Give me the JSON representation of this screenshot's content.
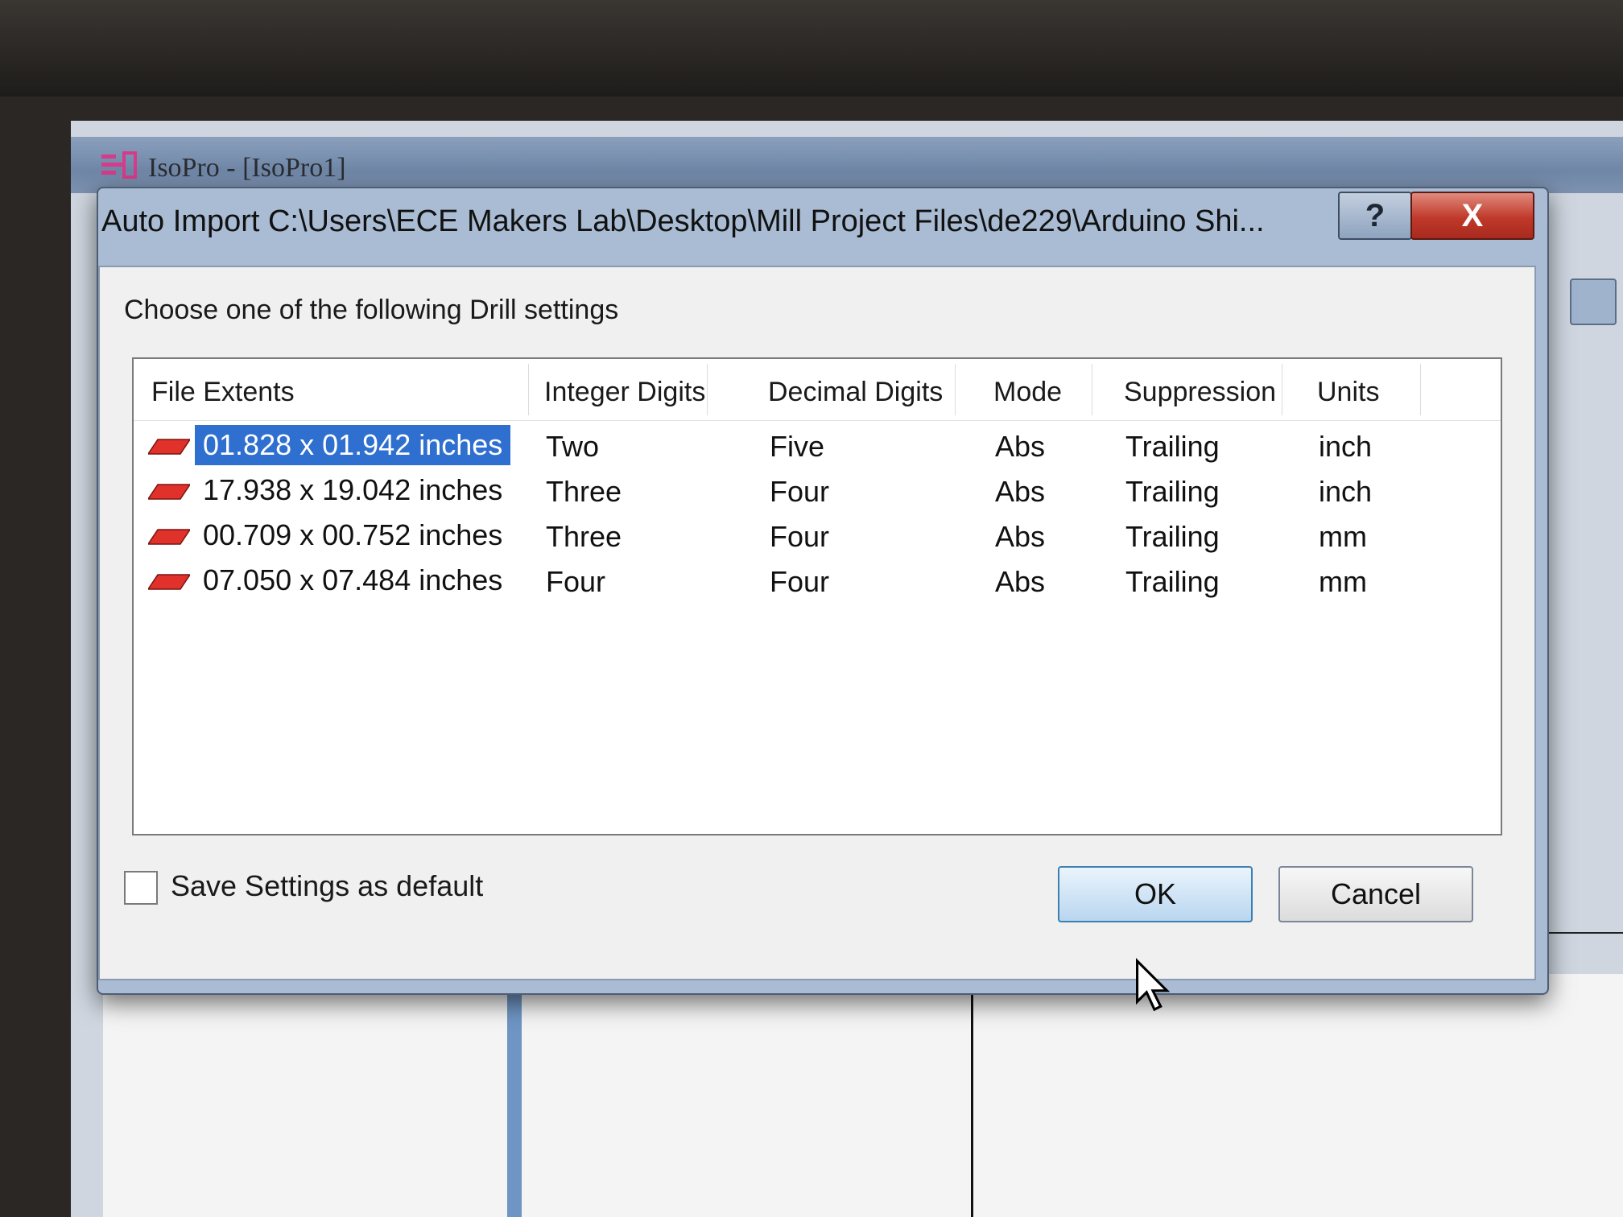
{
  "app": {
    "title": "IsoPro - [IsoPro1]"
  },
  "dialog": {
    "title": "Auto Import C:\\Users\\ECE Makers Lab\\Desktop\\Mill Project Files\\de229\\Arduino Shi...",
    "help_label": "?",
    "close_label": "X",
    "prompt": "Choose one of the following Drill settings",
    "columns": [
      "File Extents",
      "Integer Digits",
      "Decimal Digits",
      "Mode",
      "Suppression",
      "Units"
    ],
    "rows": [
      {
        "extents": "01.828 x 01.942 inches",
        "integer": "Two",
        "decimal": "Five",
        "mode": "Abs",
        "suppression": "Trailing",
        "units": "inch",
        "selected": true
      },
      {
        "extents": "17.938 x 19.042 inches",
        "integer": "Three",
        "decimal": "Four",
        "mode": "Abs",
        "suppression": "Trailing",
        "units": "inch",
        "selected": false
      },
      {
        "extents": "00.709 x 00.752 inches",
        "integer": "Three",
        "decimal": "Four",
        "mode": "Abs",
        "suppression": "Trailing",
        "units": "mm",
        "selected": false
      },
      {
        "extents": "07.050 x 07.484 inches",
        "integer": "Four",
        "decimal": "Four",
        "mode": "Abs",
        "suppression": "Trailing",
        "units": "mm",
        "selected": false
      }
    ],
    "checkbox_label": "Save Settings as default",
    "checkbox_checked": false,
    "ok_label": "OK",
    "cancel_label": "Cancel"
  },
  "colors": {
    "selection": "#2f6fd0",
    "row_icon": "#e0312a",
    "close_button": "#c0392b"
  }
}
